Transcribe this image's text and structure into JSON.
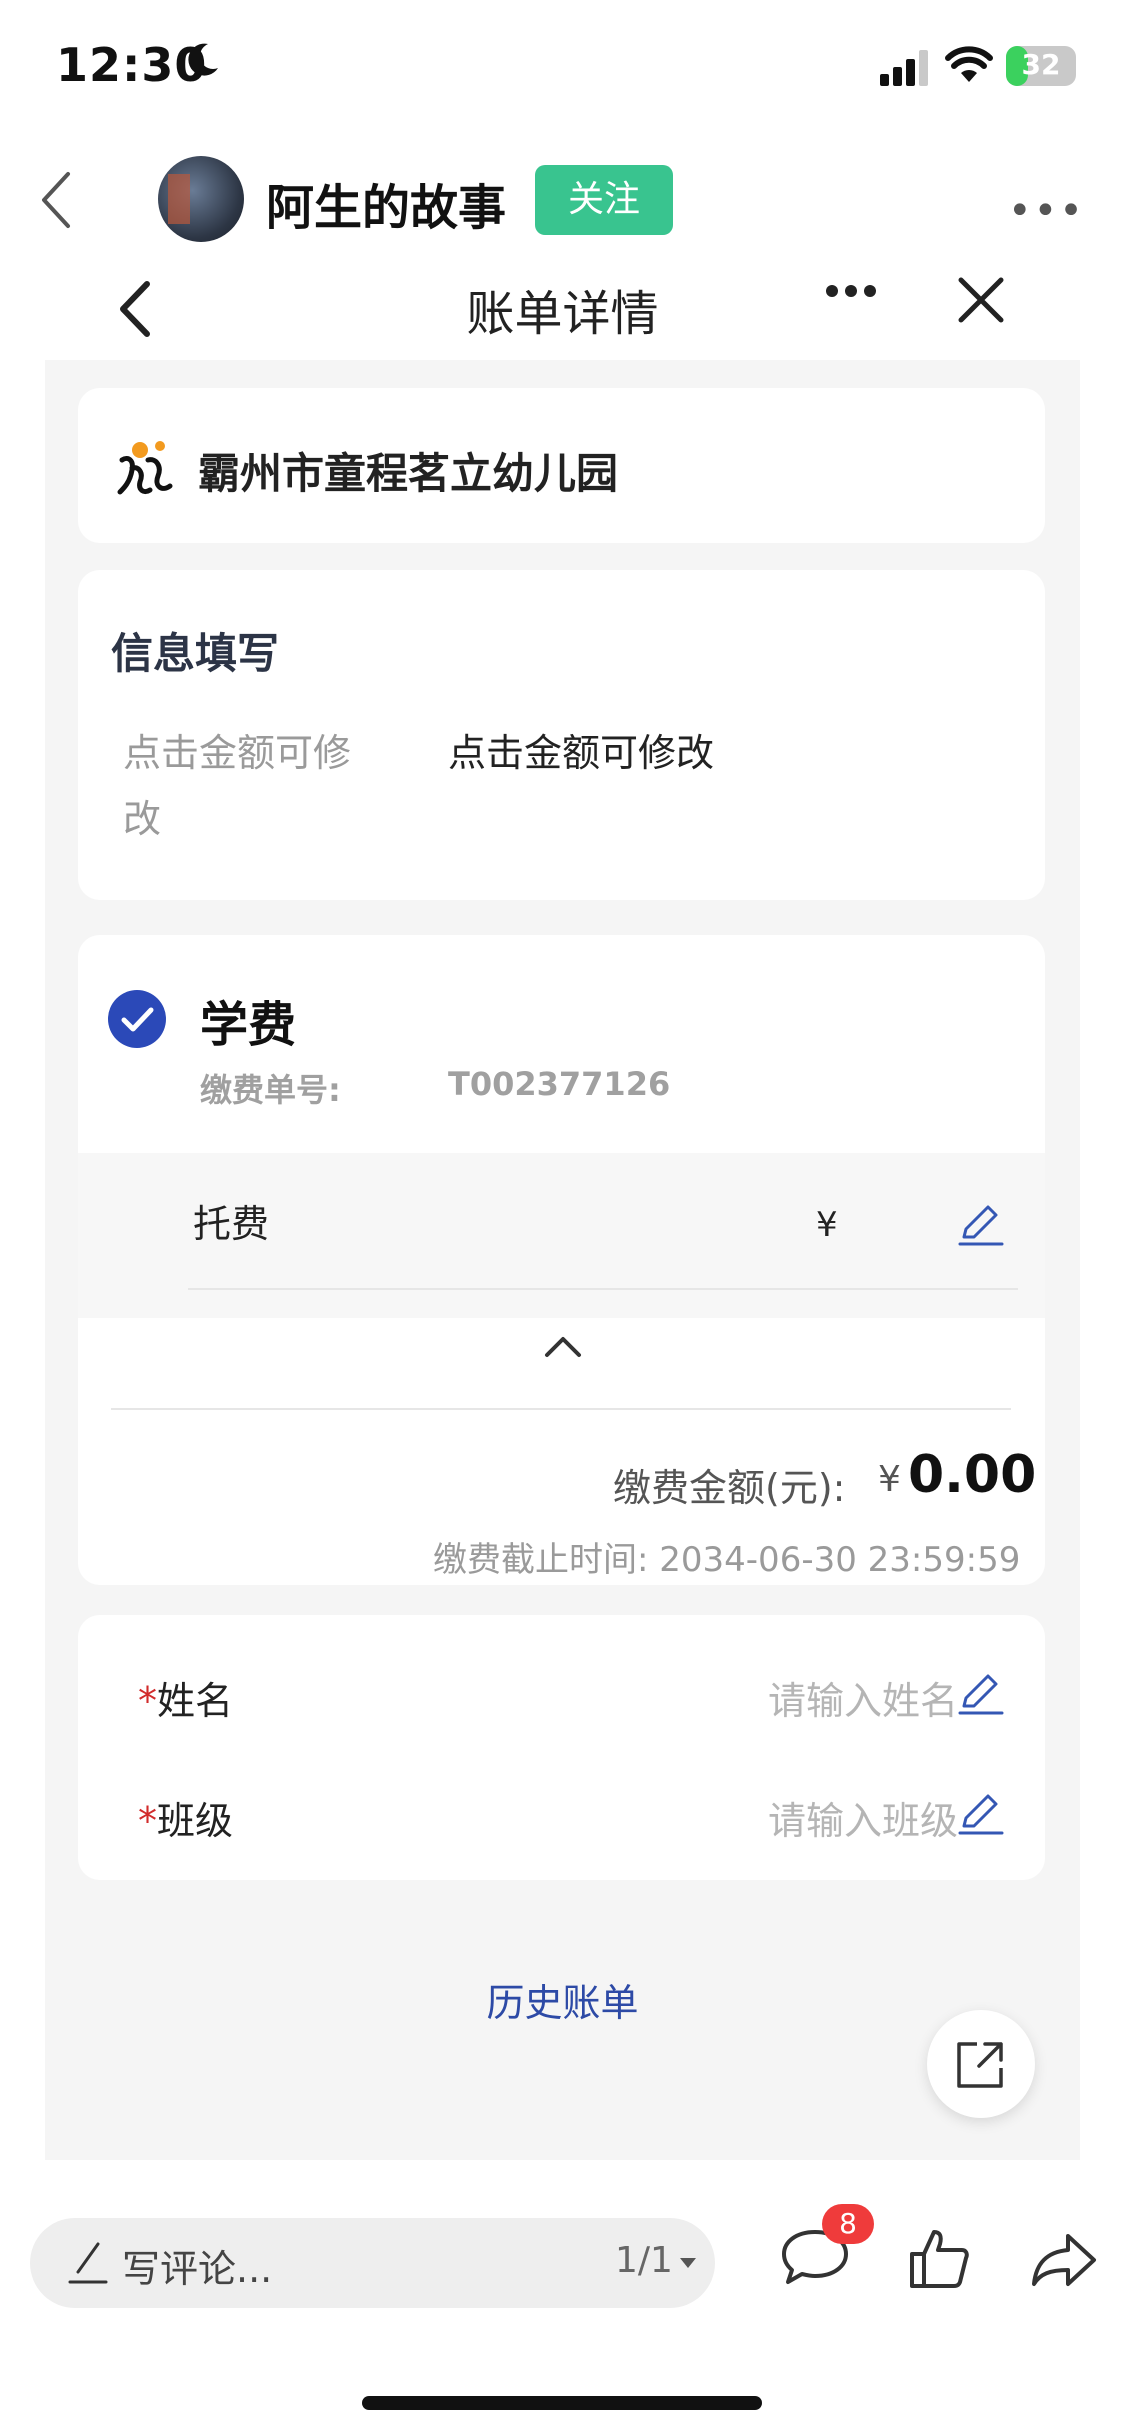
{
  "status": {
    "time": "12:30",
    "battery": "32",
    "battery_fraction": 0.32
  },
  "author": {
    "name": "阿生的故事",
    "follow_label": "关注"
  },
  "mini_program": {
    "title": "账单详情"
  },
  "school": {
    "name": "霸州市童程茗立幼儿园"
  },
  "info": {
    "title": "信息填写",
    "label": "点击金额可修改",
    "value": "点击金额可修改"
  },
  "fee": {
    "name": "学费",
    "order_label": "缴费单号:",
    "order_number": "T002377126",
    "item_name": "托费",
    "item_currency": "¥",
    "total_label": "缴费金额(元):",
    "total_currency": "¥",
    "total_amount": "0.00",
    "deadline": "缴费截止时间: 2034-06-30 23:59:59"
  },
  "form": {
    "required_mark": "*",
    "name_label": "姓名",
    "name_placeholder": "请输入姓名",
    "class_label": "班级",
    "class_placeholder": "请输入班级"
  },
  "history_label": "历史账单",
  "bottom": {
    "comment_placeholder": "写评论...",
    "page_indicator": "1/1",
    "comment_badge": "8"
  },
  "colors": {
    "follow_green": "#39c48f",
    "check_blue": "#2b49b8",
    "link_blue": "#2d4aa6",
    "required_red": "#d12b2b",
    "badge_red": "#ef3b3b"
  }
}
